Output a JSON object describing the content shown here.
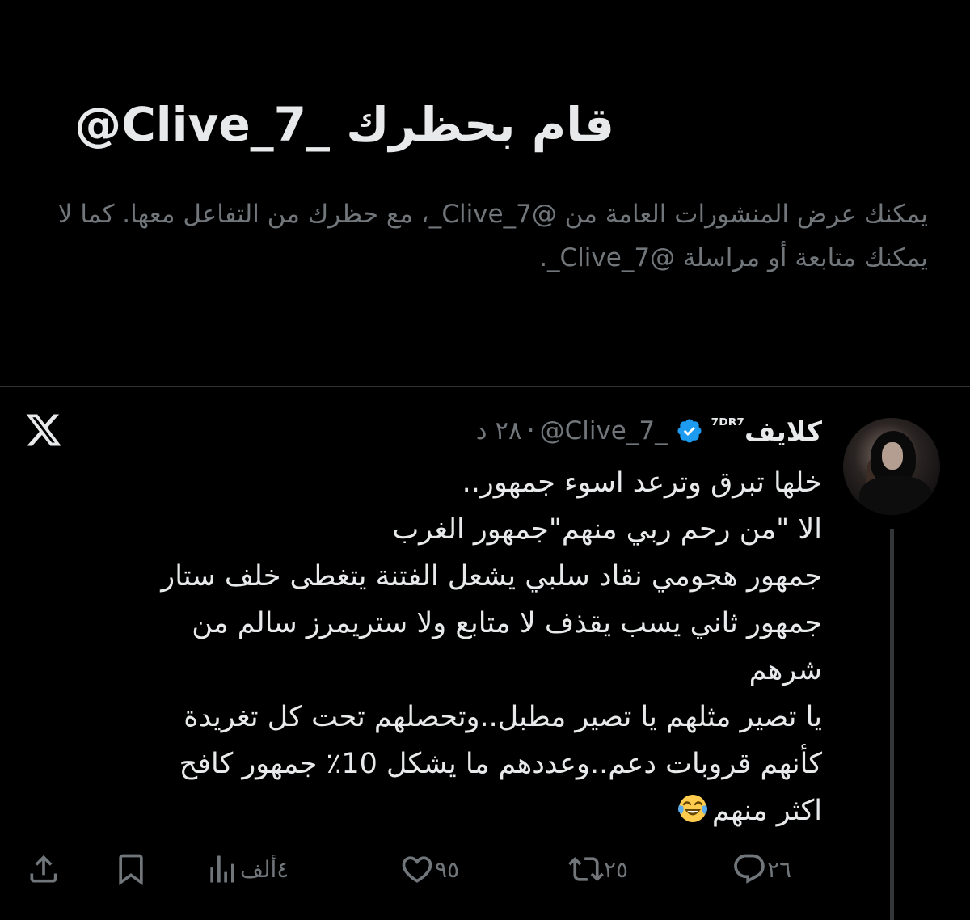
{
  "blocked": {
    "title": "قام بحظرك _Clive_7@",
    "description": "يمكنك عرض المنشورات العامة من @Clive_7_، مع حظرك من التفاعل معها. كما لا يمكنك متابعة أو مراسلة @Clive_7_."
  },
  "tweet": {
    "display_name": "كلايف",
    "display_name_suffix": "⁷ᴰᴿ⁷",
    "handle": "@Clive_7_",
    "separator": "·",
    "time": "٢٨ د",
    "lines": [
      "خلها تبرق وترعد اسوء جمهور..",
      "الا \"من رحم ربي منهم\"جمهور الغرب",
      "جمهور هجومي نقاد سلبي يشعل الفتنة يتغطى خلف ستار",
      "جمهور ثاني يسب يقذف لا متابع ولا ستريمرز سالم من",
      "شرهم",
      "يا تصير مثلهم يا تصير مطبل..وتحصلهم تحت كل تغريدة",
      "كأنهم قروبات دعم..وعددهم ما يشكل 10٪  جمهور كافح",
      "اكثر منهم"
    ],
    "emoji": "face-with-tears-of-joy"
  },
  "actions": {
    "reply_count": "٢٦",
    "retweet_count": "٢٥",
    "like_count": "٩٥",
    "views_count": "٤ألف"
  },
  "colors": {
    "background": "#000000",
    "text_primary": "#e7e9ea",
    "text_secondary": "#71767b",
    "verified": "#1d9bf0",
    "divider": "#2f3336"
  },
  "icons": {
    "brand": "x-logo-icon",
    "verified": "verified-badge-icon",
    "reply": "reply-icon",
    "retweet": "retweet-icon",
    "like": "heart-icon",
    "views": "views-chart-icon",
    "bookmark": "bookmark-icon",
    "share": "share-icon"
  }
}
